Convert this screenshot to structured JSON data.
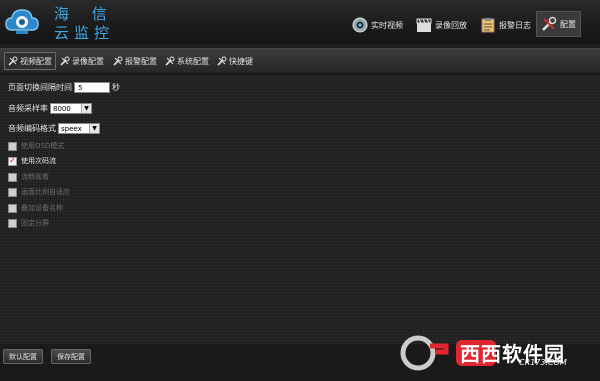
{
  "app": {
    "brand_line1": "海 信",
    "brand_line2": "云监控"
  },
  "nav": [
    {
      "label": "实时视频",
      "icon": "camera-icon"
    },
    {
      "label": "录像回放",
      "icon": "clapperboard-icon"
    },
    {
      "label": "报警日志",
      "icon": "clipboard-icon"
    },
    {
      "label": "配置",
      "icon": "tools-icon"
    }
  ],
  "tabs": [
    {
      "label": "视频配置"
    },
    {
      "label": "录像配置"
    },
    {
      "label": "报警配置"
    },
    {
      "label": "系统配置"
    },
    {
      "label": "快捷键"
    }
  ],
  "video": {
    "page_switch_label": "页面切换间隔时间",
    "page_switch_value": "5",
    "page_switch_unit": "秒",
    "sample_rate_label": "音频采样率",
    "sample_rate_value": "8000",
    "codec_label": "音频编码格式",
    "codec_value": "speex"
  },
  "options": [
    {
      "label": "使用OSD模式",
      "checked": false,
      "enabled": false
    },
    {
      "label": "使用次码流",
      "checked": true,
      "enabled": true
    },
    {
      "label": "流畅观看",
      "checked": false,
      "enabled": false
    },
    {
      "label": "画面比例自适应",
      "checked": false,
      "enabled": false
    },
    {
      "label": "叠加设备名称",
      "checked": false,
      "enabled": false
    },
    {
      "label": "固定分屏",
      "checked": false,
      "enabled": false
    }
  ],
  "buttons": {
    "default_label": "默认配置",
    "save_label": "保存配置"
  },
  "watermark": {
    "text": "西西软件园",
    "sub": "CR173.COM"
  },
  "colors": {
    "brand": "#3fa9e6",
    "watermark": "#e0262f"
  }
}
